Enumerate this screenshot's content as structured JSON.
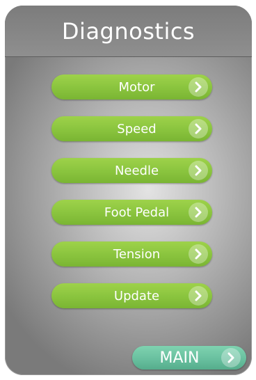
{
  "header": {
    "title": "Diagnostics"
  },
  "menu": {
    "items": [
      {
        "label": "Motor",
        "icon": "chevron-right-icon"
      },
      {
        "label": "Speed",
        "icon": "chevron-right-icon"
      },
      {
        "label": "Needle",
        "icon": "chevron-right-icon"
      },
      {
        "label": "Foot Pedal",
        "icon": "chevron-right-icon"
      },
      {
        "label": "Tension",
        "icon": "chevron-right-icon"
      },
      {
        "label": "Update",
        "icon": "chevron-right-icon"
      }
    ]
  },
  "footer": {
    "main_label": "MAIN"
  },
  "colors": {
    "menu_button": "#8bc53f",
    "main_button": "#69c09f",
    "title_bar": "#888888",
    "text": "#ffffff"
  }
}
